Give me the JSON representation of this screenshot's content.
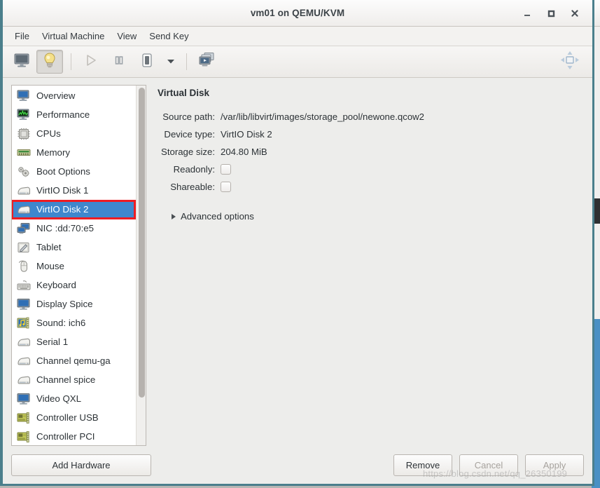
{
  "window": {
    "title": "vm01 on QEMU/KVM",
    "minimize_label": "_",
    "maximize_label": "□",
    "close_label": "✕"
  },
  "menubar": {
    "items": [
      {
        "label": "File",
        "name": "menu-file"
      },
      {
        "label": "Virtual Machine",
        "name": "menu-virtual-machine"
      },
      {
        "label": "View",
        "name": "menu-view"
      },
      {
        "label": "Send Key",
        "name": "menu-send-key"
      }
    ]
  },
  "toolbar": {
    "buttons": [
      {
        "icon": "console-monitor-icon",
        "label": "Console",
        "state": "normal"
      },
      {
        "icon": "lightbulb-details-icon",
        "label": "Details",
        "state": "pressed"
      },
      {
        "icon": "play-run-icon",
        "label": "Run",
        "state": "disabled"
      },
      {
        "icon": "pause-icon",
        "label": "Pause",
        "state": "normal"
      },
      {
        "icon": "shutdown-icon",
        "label": "Shut Down",
        "state": "normal"
      },
      {
        "icon": "chevron-down-icon",
        "label": "Shutdown options",
        "state": "normal"
      },
      {
        "icon": "snapshots-icon",
        "label": "Snapshots",
        "state": "normal"
      }
    ],
    "fullscreen": {
      "icon": "fullscreen-resize-icon",
      "label": "Fullscreen",
      "state": "disabled"
    }
  },
  "sidebar": {
    "items": [
      {
        "label": "Overview",
        "icon": "computer-monitor-icon",
        "selected": false
      },
      {
        "label": "Performance",
        "icon": "performance-graph-icon",
        "selected": false
      },
      {
        "label": "CPUs",
        "icon": "cpu-chip-icon",
        "selected": false
      },
      {
        "label": "Memory",
        "icon": "memory-ram-icon",
        "selected": false
      },
      {
        "label": "Boot Options",
        "icon": "gears-icon",
        "selected": false
      },
      {
        "label": "VirtIO Disk 1",
        "icon": "harddisk-icon",
        "selected": false
      },
      {
        "label": "VirtIO Disk 2",
        "icon": "harddisk-icon",
        "selected": true
      },
      {
        "label": "NIC :dd:70:e5",
        "icon": "network-card-icon",
        "selected": false
      },
      {
        "label": "Tablet",
        "icon": "tablet-pen-icon",
        "selected": false
      },
      {
        "label": "Mouse",
        "icon": "mouse-icon",
        "selected": false
      },
      {
        "label": "Keyboard",
        "icon": "keyboard-icon",
        "selected": false
      },
      {
        "label": "Display Spice",
        "icon": "display-screen-icon",
        "selected": false
      },
      {
        "label": "Sound: ich6",
        "icon": "sound-card-icon",
        "selected": false
      },
      {
        "label": "Serial 1",
        "icon": "serial-port-icon",
        "selected": false
      },
      {
        "label": "Channel qemu-ga",
        "icon": "serial-port-icon",
        "selected": false
      },
      {
        "label": "Channel spice",
        "icon": "serial-port-icon",
        "selected": false
      },
      {
        "label": "Video QXL",
        "icon": "display-screen-icon",
        "selected": false
      },
      {
        "label": "Controller USB",
        "icon": "controller-card-icon",
        "selected": false
      },
      {
        "label": "Controller PCI",
        "icon": "controller-card-icon",
        "selected": false
      }
    ]
  },
  "panel": {
    "title": "Virtual Disk",
    "fields": [
      {
        "label": "Source path:",
        "value": "/var/lib/libvirt/images/storage_pool/newone.qcow2",
        "type": "text"
      },
      {
        "label": "Device type:",
        "value": "VirtIO Disk 2",
        "type": "text"
      },
      {
        "label": "Storage size:",
        "value": "204.80 MiB",
        "type": "text"
      },
      {
        "label": "Readonly:",
        "value": "",
        "type": "checkbox",
        "checked": false
      },
      {
        "label": "Shareable:",
        "value": "",
        "type": "checkbox",
        "checked": false
      }
    ],
    "advanced_options_label": "Advanced options"
  },
  "footer": {
    "add_hardware_label": "Add Hardware",
    "remove_label": "Remove",
    "cancel_label": "Cancel",
    "apply_label": "Apply",
    "remove_enabled": true,
    "cancel_enabled": false,
    "apply_enabled": false
  },
  "watermark": "https://blog.csdn.net/qq_26350199",
  "colors": {
    "selection_blue": "#3f87cd",
    "annotation_red": "#ee1c22",
    "window_border": "#4b7f8c",
    "panel_bg": "#ededeb"
  }
}
